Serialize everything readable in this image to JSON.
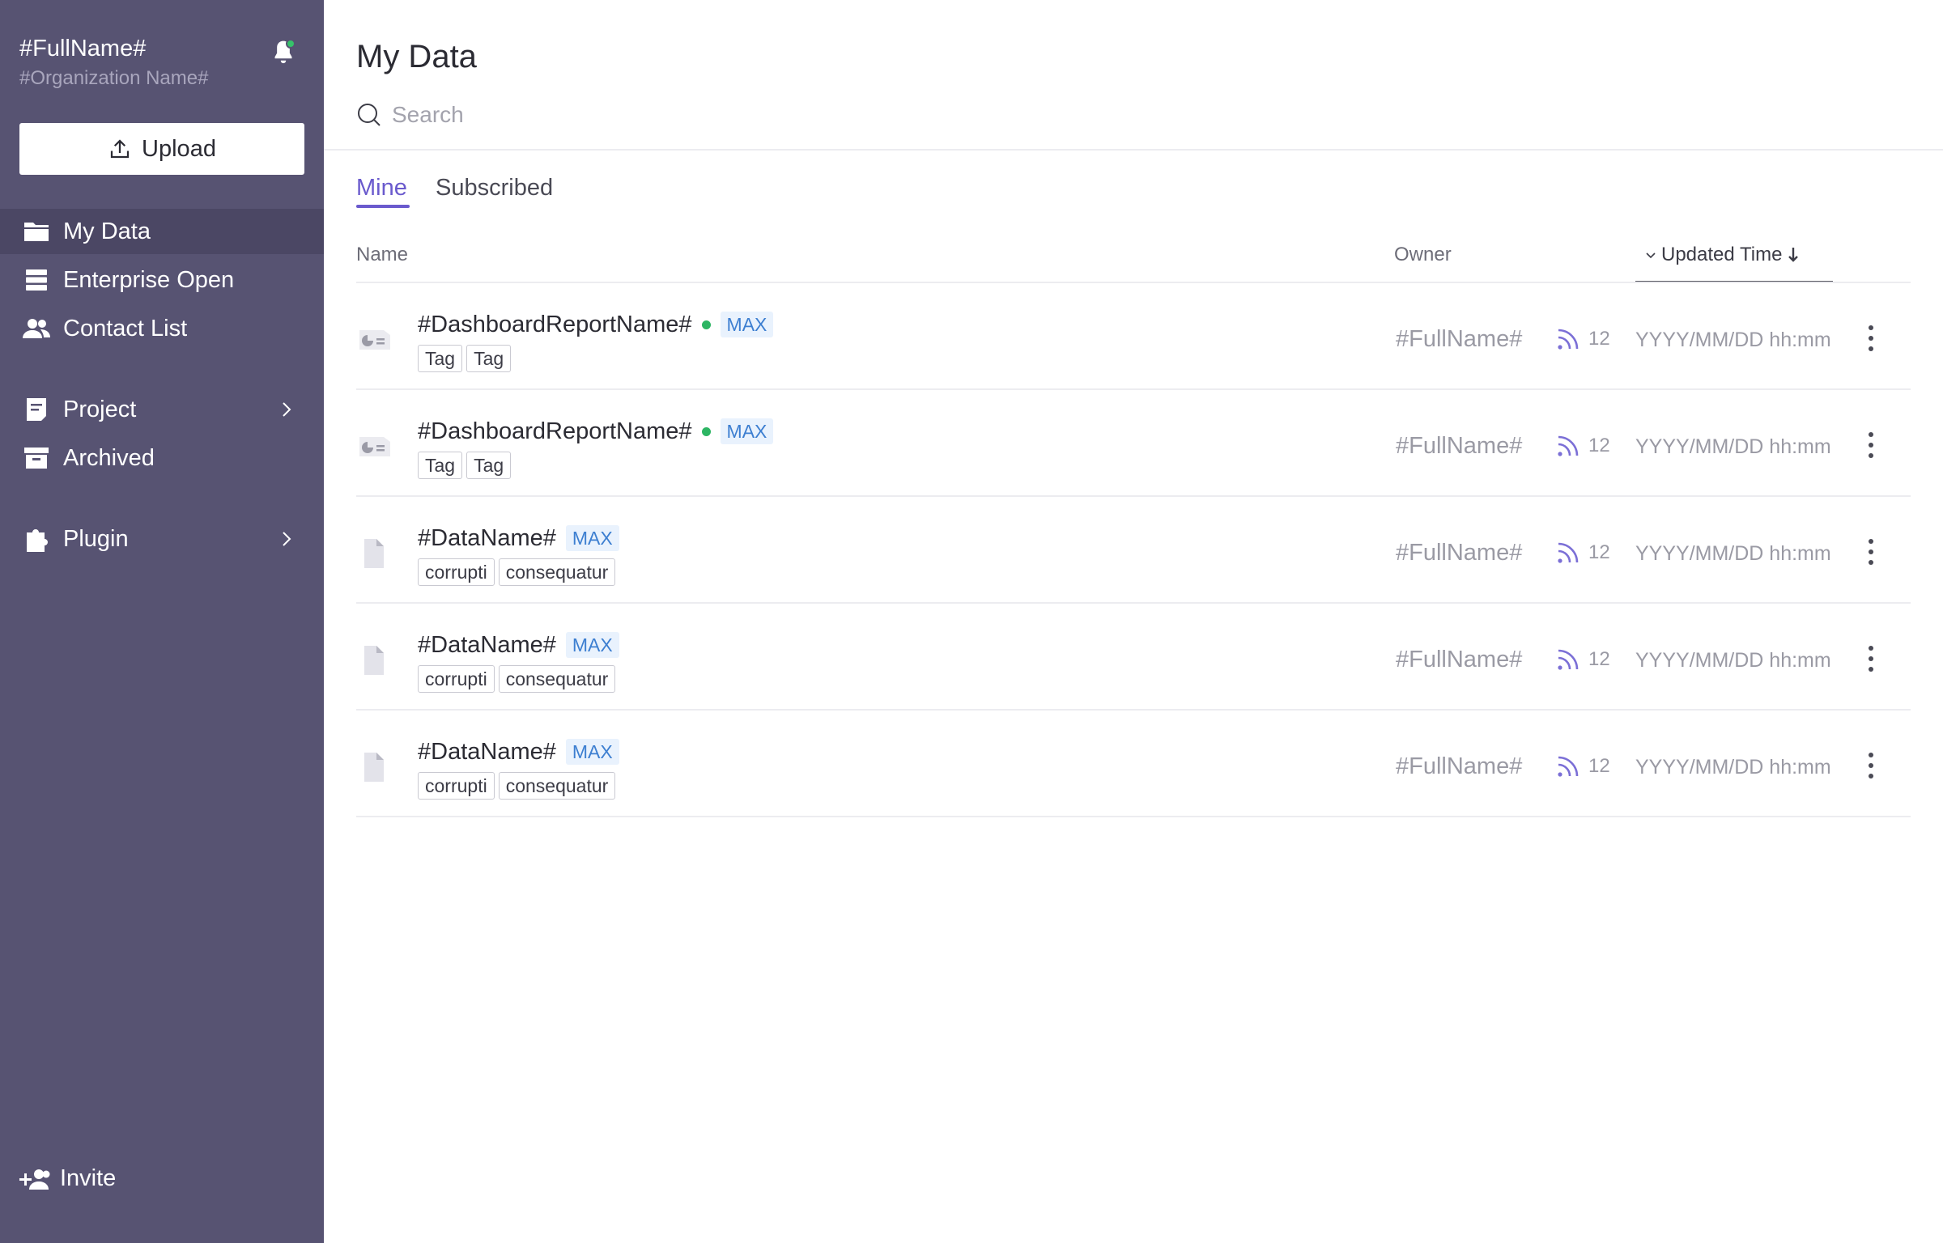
{
  "sidebar": {
    "user_name": "#FullName#",
    "org_name": "#Organization Name#",
    "upload_label": "Upload",
    "nav": [
      {
        "label": "My Data",
        "icon": "folder-icon",
        "active": true
      },
      {
        "label": "Enterprise Open",
        "icon": "database-icon"
      },
      {
        "label": "Contact List",
        "icon": "users-icon"
      },
      {
        "label": "Project",
        "icon": "document-icon",
        "has_submenu": true
      },
      {
        "label": "Archived",
        "icon": "archive-icon"
      },
      {
        "label": "Plugin",
        "icon": "puzzle-icon",
        "has_submenu": true
      }
    ],
    "invite_label": "Invite"
  },
  "main": {
    "title": "My Data",
    "search_placeholder": "Search",
    "tabs": [
      {
        "label": "Mine",
        "active": true
      },
      {
        "label": "Subscribed",
        "active": false
      }
    ],
    "columns": {
      "name": "Name",
      "owner": "Owner",
      "updated": "Updated Time"
    },
    "rows": [
      {
        "type": "dashboard",
        "name": "#DashboardReportName#",
        "online": true,
        "badge": "MAX",
        "tags": [
          "Tag",
          "Tag"
        ],
        "owner": "#FullName#",
        "subscribers": "12",
        "updated": "YYYY/MM/DD hh:mm"
      },
      {
        "type": "dashboard",
        "name": "#DashboardReportName#",
        "online": true,
        "badge": "MAX",
        "tags": [
          "Tag",
          "Tag"
        ],
        "owner": "#FullName#",
        "subscribers": "12",
        "updated": "YYYY/MM/DD hh:mm"
      },
      {
        "type": "data",
        "name": "#DataName#",
        "online": false,
        "badge": "MAX",
        "tags": [
          "corrupti",
          "consequatur"
        ],
        "owner": "#FullName#",
        "subscribers": "12",
        "updated": "YYYY/MM/DD hh:mm"
      },
      {
        "type": "data",
        "name": "#DataName#",
        "online": false,
        "badge": "MAX",
        "tags": [
          "corrupti",
          "consequatur"
        ],
        "owner": "#FullName#",
        "subscribers": "12",
        "updated": "YYYY/MM/DD hh:mm"
      },
      {
        "type": "data",
        "name": "#DataName#",
        "online": false,
        "badge": "MAX",
        "tags": [
          "corrupti",
          "consequatur"
        ],
        "owner": "#FullName#",
        "subscribers": "12",
        "updated": "YYYY/MM/DD hh:mm"
      }
    ]
  },
  "colors": {
    "sidebar_bg": "#575372",
    "accent": "#6a5acd",
    "online": "#2db563",
    "badge": "#3d7fd1"
  }
}
